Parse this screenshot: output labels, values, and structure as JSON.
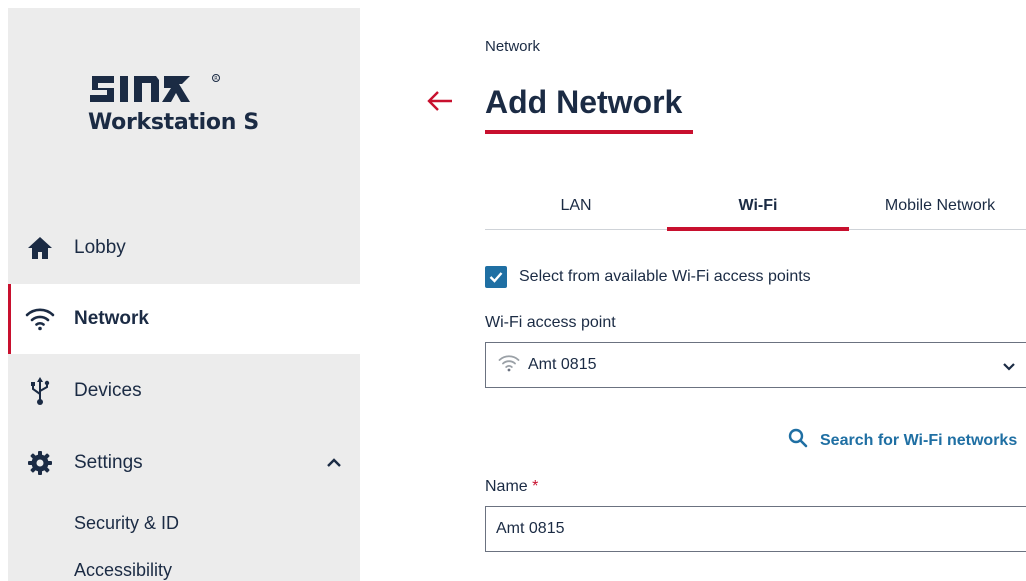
{
  "sidebar": {
    "logo": {
      "brand": "SINA",
      "product": "Workstation S"
    },
    "items": [
      {
        "label": "Lobby",
        "icon": "home-icon"
      },
      {
        "label": "Network",
        "icon": "wifi-icon",
        "active": true
      },
      {
        "label": "Devices",
        "icon": "usb-icon"
      },
      {
        "label": "Settings",
        "icon": "gear-icon",
        "expanded": true
      }
    ],
    "sub_items": [
      {
        "label": "Security & ID"
      },
      {
        "label": "Accessibility"
      }
    ]
  },
  "main": {
    "breadcrumb": "Network",
    "title": "Add Network",
    "tabs": [
      {
        "label": "LAN"
      },
      {
        "label": "Wi-Fi",
        "active": true
      },
      {
        "label": "Mobile Network"
      }
    ],
    "checkbox": {
      "label": "Select from available Wi-Fi access points",
      "checked": true
    },
    "access_point": {
      "label": "Wi-Fi access point",
      "value": "Amt 0815"
    },
    "search_link": "Search for Wi-Fi networks",
    "name_field": {
      "label": "Name",
      "required_mark": "*",
      "value": "Amt 0815"
    }
  },
  "colors": {
    "accent": "#c8102e",
    "link": "#1f6fa3",
    "text": "#1b2b44",
    "sidebar_bg": "#ececec"
  }
}
